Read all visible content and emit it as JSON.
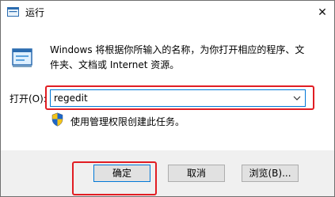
{
  "window": {
    "title": "运行",
    "close_glyph": "✕"
  },
  "dialog": {
    "description": "Windows 将根据你所输入的名称，为你打开相应的程序、文件夹、文档或 Internet 资源。",
    "open_label": "打开(O):",
    "input_value": "regedit",
    "admin_note": "使用管理权限创建此任务。"
  },
  "buttons": {
    "ok": "确定",
    "cancel": "取消",
    "browse": "浏览(B)..."
  },
  "icons": {
    "app": "run-app-icon",
    "dialog": "run-dialog-icon",
    "shield": "uac-shield-icon",
    "dropdown": "chevron-down-icon"
  },
  "colors": {
    "accent": "#0078d7",
    "highlight": "#e11d23",
    "footer_bg": "#f0f0f0"
  }
}
